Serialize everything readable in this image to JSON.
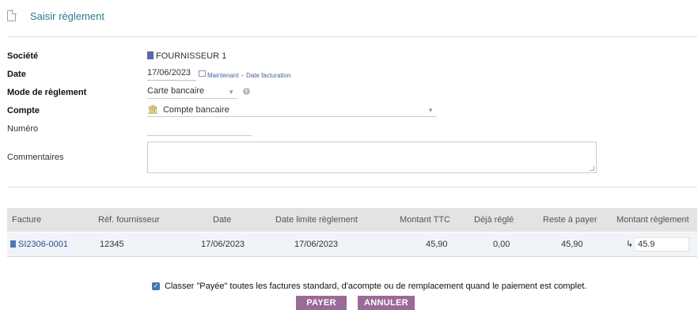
{
  "header": {
    "title": "Saisir règlement"
  },
  "form": {
    "societe": {
      "label": "Société",
      "value": "FOURNISSEUR 1"
    },
    "date": {
      "label": "Date",
      "value": "17/06/2023",
      "now_link": "Maintenant",
      "dash": "-",
      "billing_link": "Date facturation"
    },
    "mode": {
      "label": "Mode de règlement",
      "value": "Carte bancaire"
    },
    "compte": {
      "label": "Compte",
      "value": "Compte bancaire"
    },
    "numero": {
      "label": "Numéro",
      "value": ""
    },
    "commentaires": {
      "label": "Commentaires",
      "value": ""
    }
  },
  "table": {
    "headers": [
      "Facture",
      "Réf. fournisseur",
      "Date",
      "Date limite règlement",
      "Montant TTC",
      "Déjà réglé",
      "Reste à payer",
      "Montant règlement"
    ],
    "rows": [
      {
        "facture": "SI2306-0001",
        "ref": "12345",
        "date": "17/06/2023",
        "date_limite": "17/06/2023",
        "montant_ttc": "45,90",
        "deja_regle": "0,00",
        "reste": "45,90",
        "arrow": "↳",
        "montant_reglement": "45.9"
      }
    ]
  },
  "options": {
    "classer_label": "Classer \"Payée\" toutes les factures standard, d'acompte ou de remplacement quand le paiement est complet.",
    "classer_checked": true
  },
  "actions": {
    "pay": "PAYER",
    "cancel": "ANNULER"
  },
  "icons": {
    "title": "document-icon",
    "societe": "building-icon",
    "date": "calendar-icon",
    "mode": "info-icon",
    "compte": "bank-icon",
    "facture": "invoice-icon"
  },
  "colors": {
    "accent": "#2b7a8c",
    "button": "#9b6b98",
    "link": "#4a5f9f",
    "checkbox": "#4a72b5"
  }
}
